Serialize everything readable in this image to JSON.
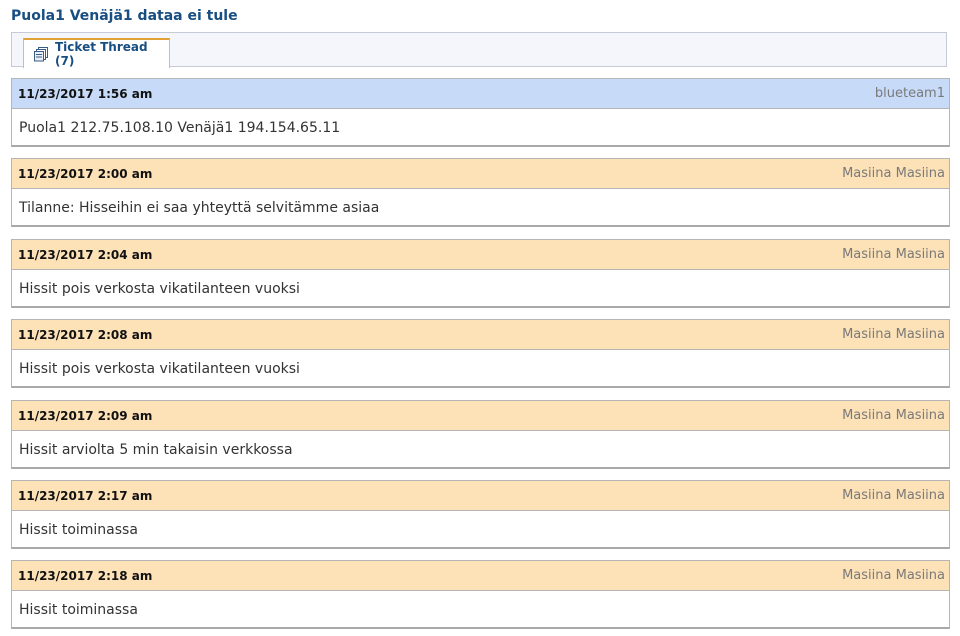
{
  "ticket": {
    "title": "Puola1 Venäjä1 dataa ei tule"
  },
  "tabs": [
    {
      "label": "Ticket Thread (7)",
      "icon": "thread-icon",
      "active": true
    }
  ],
  "colors": {
    "title": "#184e81",
    "response_header": "#c7daf8",
    "note_header": "#fde1b7",
    "tab_accent": "#e0a234"
  },
  "thread": [
    {
      "type": "response",
      "date": "11/23/2017 1:56 am",
      "author": "blueteam1",
      "body": "Puola1 212.75.108.10 Venäjä1 194.154.65.11"
    },
    {
      "type": "note",
      "date": "11/23/2017 2:00 am",
      "author": "Masiina Masiina",
      "body": "Tilanne: Hisseihin ei saa yhteyttä selvitämme asiaa"
    },
    {
      "type": "note",
      "date": "11/23/2017 2:04 am",
      "author": "Masiina Masiina",
      "body": "Hissit pois verkosta vikatilanteen vuoksi"
    },
    {
      "type": "note",
      "date": "11/23/2017 2:08 am",
      "author": "Masiina Masiina",
      "body": "Hissit pois verkosta vikatilanteen vuoksi"
    },
    {
      "type": "note",
      "date": "11/23/2017 2:09 am",
      "author": "Masiina Masiina",
      "body": "Hissit arviolta 5 min takaisin verkkossa"
    },
    {
      "type": "note",
      "date": "11/23/2017 2:17 am",
      "author": "Masiina Masiina",
      "body": "Hissit toiminassa"
    },
    {
      "type": "note",
      "date": "11/23/2017 2:18 am",
      "author": "Masiina Masiina",
      "body": "Hissit toiminassa"
    }
  ]
}
